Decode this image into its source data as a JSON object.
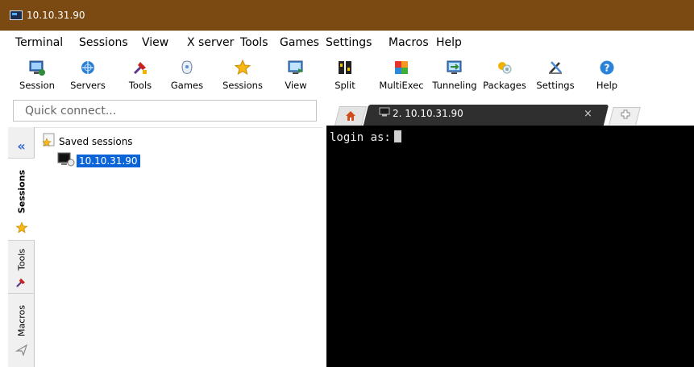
{
  "window": {
    "title": "10.10.31.90"
  },
  "menu": [
    "Terminal",
    "Sessions",
    "View",
    "X server",
    "Tools",
    "Games",
    "Settings",
    "Macros",
    "Help"
  ],
  "toolbar": [
    {
      "label": "Session",
      "icon": "session-icon"
    },
    {
      "label": "Servers",
      "icon": "servers-icon"
    },
    {
      "label": "Tools",
      "icon": "tools-icon"
    },
    {
      "label": "Games",
      "icon": "games-icon"
    },
    {
      "label": "Sessions",
      "icon": "star-icon"
    },
    {
      "label": "View",
      "icon": "view-icon"
    },
    {
      "label": "Split",
      "icon": "split-icon"
    },
    {
      "label": "MultiExec",
      "icon": "multiexec-icon"
    },
    {
      "label": "Tunneling",
      "icon": "tunneling-icon"
    },
    {
      "label": "Packages",
      "icon": "packages-icon"
    },
    {
      "label": "Settings",
      "icon": "settings-icon"
    },
    {
      "label": "Help",
      "icon": "help-icon"
    }
  ],
  "quick_connect": {
    "placeholder": "Quick connect..."
  },
  "side_tabs": [
    {
      "label": "Sessions",
      "icon": "star-icon"
    },
    {
      "label": "Tools",
      "icon": "tools-icon"
    },
    {
      "label": "Macros",
      "icon": "macros-icon"
    }
  ],
  "sessions_tree": {
    "root_label": "Saved sessions",
    "items": [
      {
        "label": "10.10.31.90"
      }
    ]
  },
  "tabs": {
    "session_tab_label": "2. 10.10.31.90",
    "close_glyph": "×"
  },
  "terminal": {
    "prompt": "login as:"
  },
  "colors": {
    "titlebar": "#7a4a12",
    "selection": "#0a64d8",
    "terminal_bg": "#000000",
    "active_tab": "#2f2f2f"
  }
}
